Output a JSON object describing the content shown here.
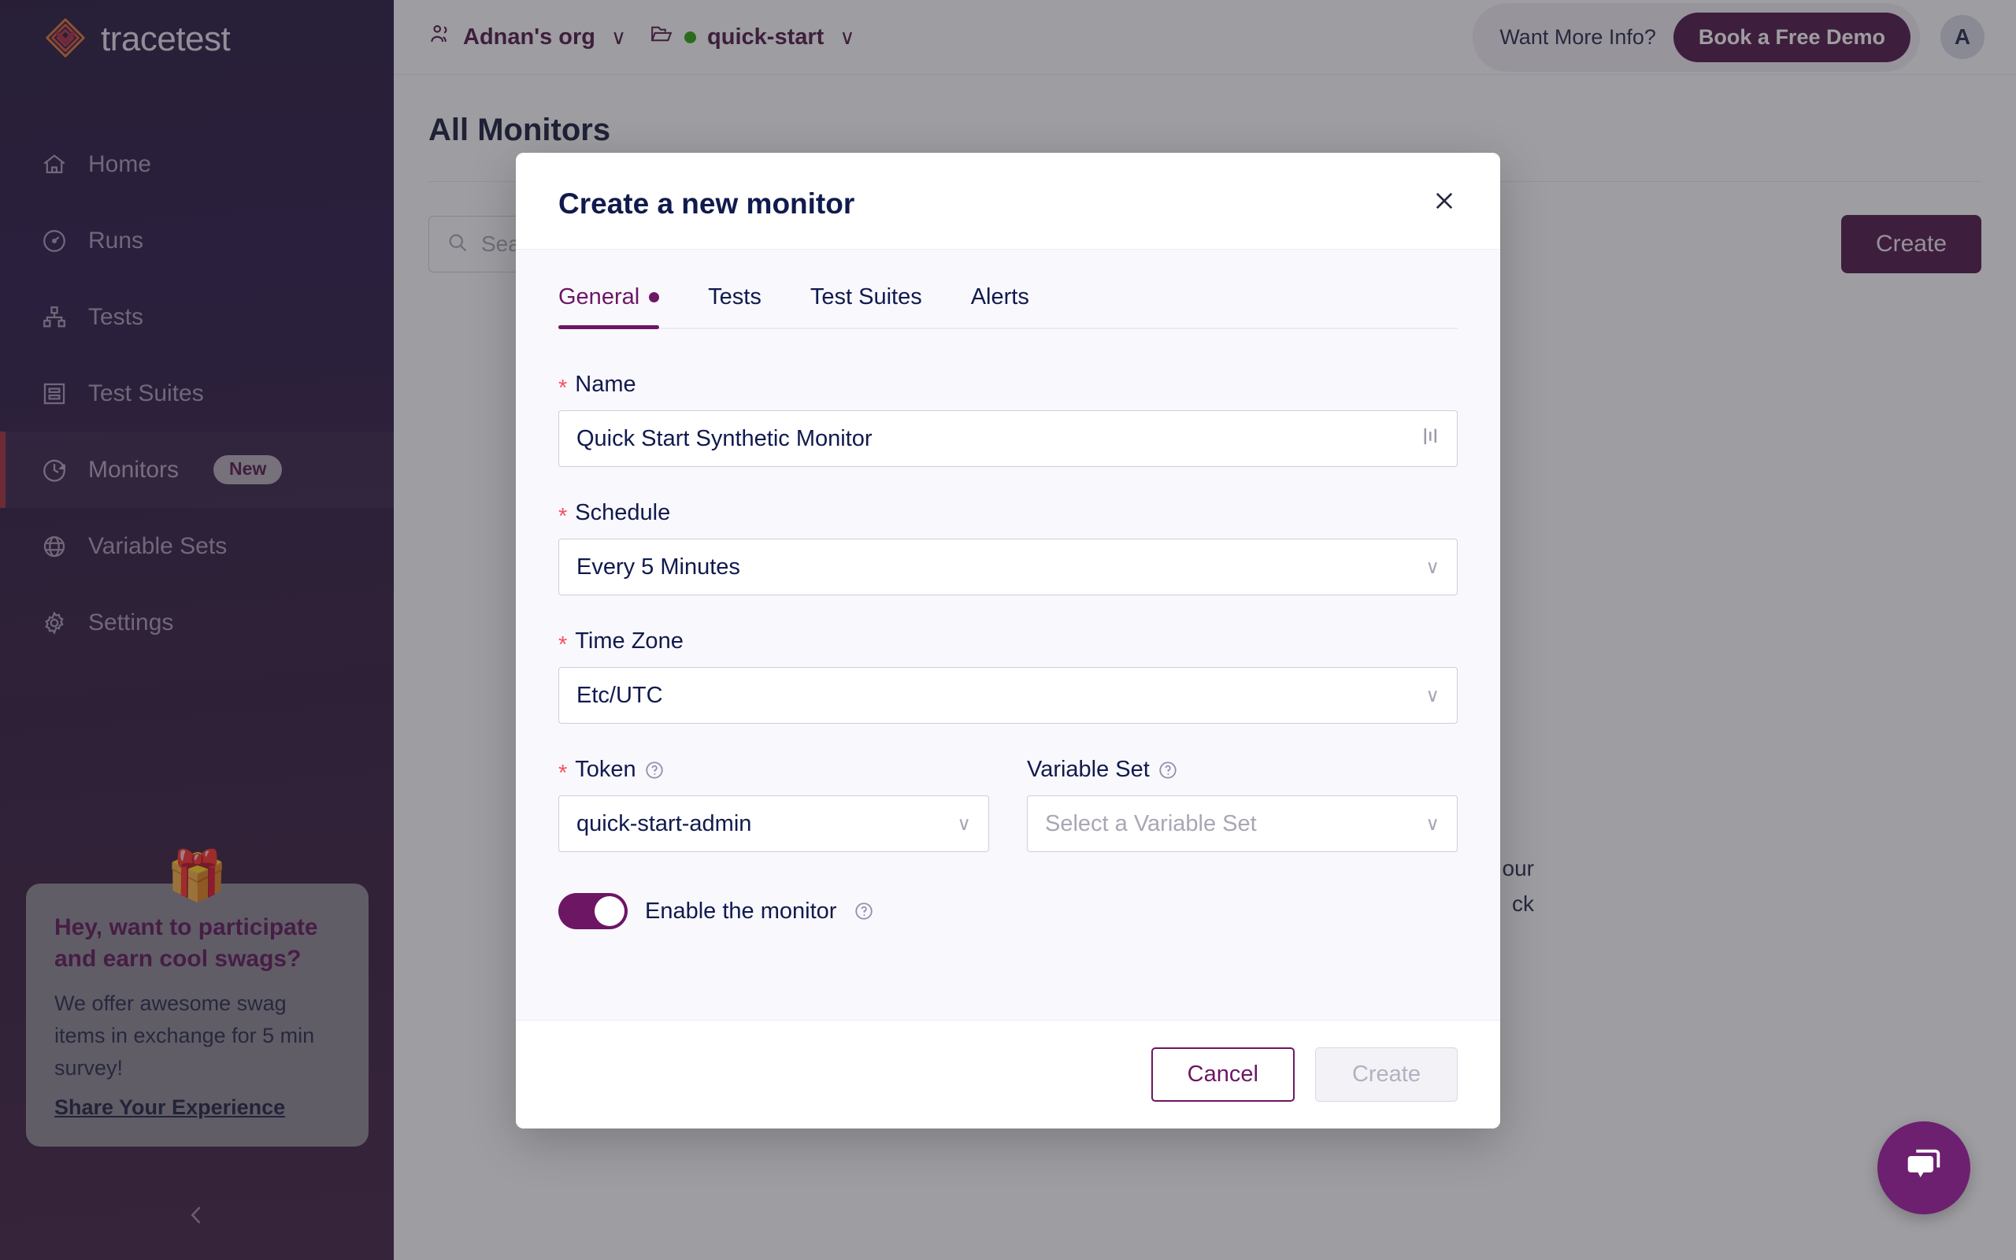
{
  "brand": {
    "name": "tracetest",
    "logo_icon": "tracetest-diamond-logo",
    "accent_purple": "#6d1663",
    "deep_purple": "#4b1042",
    "navy": "#101a4d",
    "required_red": "#f5515f"
  },
  "sidebar": {
    "items": [
      {
        "label": "Home",
        "icon": "home-icon",
        "active": false,
        "badge": ""
      },
      {
        "label": "Runs",
        "icon": "gauge-icon",
        "active": false,
        "badge": ""
      },
      {
        "label": "Tests",
        "icon": "sitemap-icon",
        "active": false,
        "badge": ""
      },
      {
        "label": "Test Suites",
        "icon": "list-box-icon",
        "active": false,
        "badge": ""
      },
      {
        "label": "Monitors",
        "icon": "clock-icon",
        "active": true,
        "badge": "New"
      },
      {
        "label": "Variable Sets",
        "icon": "globe-icon",
        "active": false,
        "badge": ""
      },
      {
        "label": "Settings",
        "icon": "gear-icon",
        "active": false,
        "badge": ""
      }
    ],
    "swag_card": {
      "gift_icon": "gift-icon",
      "title": "Hey, want to participate and earn cool swags?",
      "body": "We offer awesome swag items in exchange for 5 min survey!",
      "link": "Share Your Experience"
    },
    "collapse_icon": "chevron-left-icon"
  },
  "topbar": {
    "org": {
      "icon": "people-icon",
      "label": "Adnan's org",
      "chevron": "chevron-down-icon"
    },
    "environment": {
      "icon": "folder-icon",
      "status_dot": "#25a005",
      "label": "quick-start",
      "chevron": "chevron-down-icon"
    },
    "promo": {
      "text": "Want More Info?",
      "button": "Book a Free Demo"
    },
    "avatar": "A"
  },
  "page": {
    "title": "All Monitors",
    "search_placeholder": "Search",
    "search_icon": "search-icon",
    "create_button": "Create",
    "background_note_lines": [
      "our",
      "ck"
    ]
  },
  "modal": {
    "title": "Create a new monitor",
    "close_icon": "close-icon",
    "tabs": [
      {
        "label": "General",
        "active": true,
        "dot": true
      },
      {
        "label": "Tests",
        "active": false,
        "dot": false
      },
      {
        "label": "Test Suites",
        "active": false,
        "dot": false
      },
      {
        "label": "Alerts",
        "active": false,
        "dot": false
      }
    ],
    "fields": {
      "name": {
        "label": "Name",
        "required": true,
        "value": "Quick Start Synthetic Monitor",
        "suffix_icon": "text-wave-icon"
      },
      "schedule": {
        "label": "Schedule",
        "required": true,
        "value": "Every 5 Minutes",
        "caret": "chevron-down-icon"
      },
      "timezone": {
        "label": "Time Zone",
        "required": true,
        "value": "Etc/UTC",
        "caret": "chevron-down-icon"
      },
      "token": {
        "label": "Token",
        "required": true,
        "help_icon": "question-circle-icon",
        "value": "quick-start-admin",
        "caret": "chevron-down-icon"
      },
      "variable_set": {
        "label": "Variable Set",
        "required": false,
        "help_icon": "question-circle-icon",
        "placeholder": "Select a Variable Set",
        "caret": "chevron-down-icon"
      },
      "enable_monitor": {
        "label": "Enable the monitor",
        "help_icon": "question-circle-icon",
        "checked": true
      }
    },
    "footer": {
      "cancel": "Cancel",
      "create": "Create",
      "create_disabled": true
    }
  },
  "chat_widget": {
    "icon": "chat-bubble-icon",
    "color": "#6d1f70"
  }
}
